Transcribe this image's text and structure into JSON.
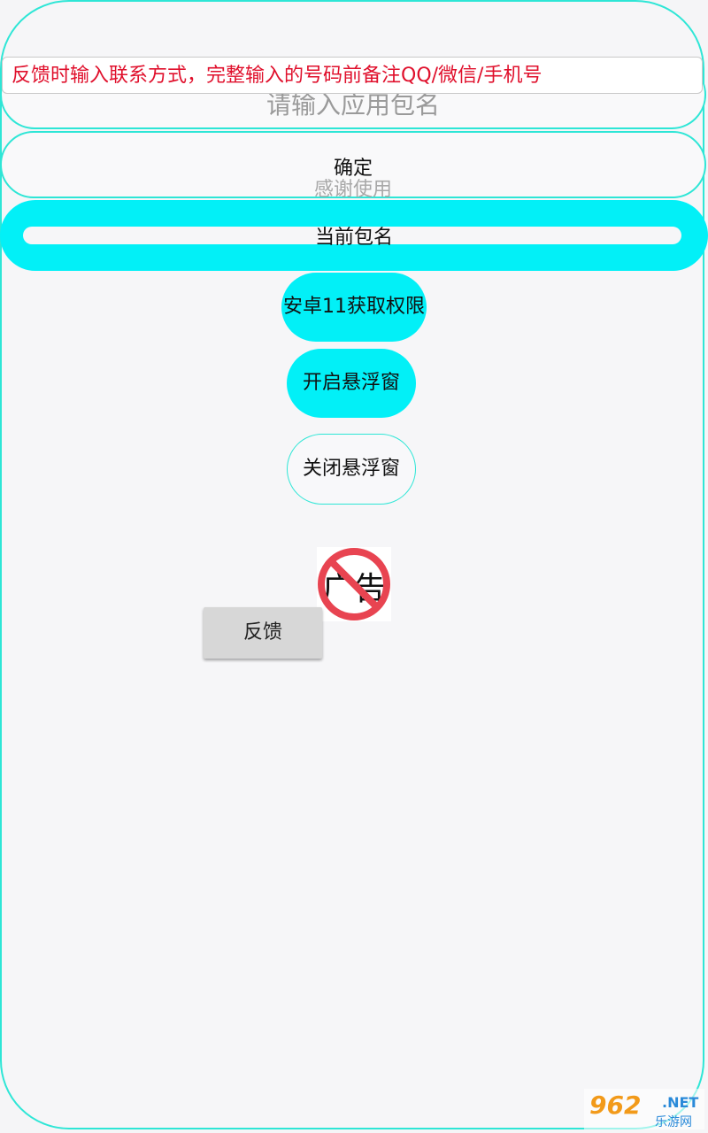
{
  "package_input": {
    "placeholder": "请输入应用包名"
  },
  "tip_banner": {
    "text": "反馈时输入联系方式，完整输入的号码前备注QQ/微信/手机号"
  },
  "confirm": {
    "label": "确定",
    "subtitle": "感谢使用"
  },
  "current_package": {
    "label": "当前包名"
  },
  "buttons": {
    "android11_permission": "安卓11获取权限",
    "open_float": "开启悬浮窗",
    "close_float": "关闭悬浮窗",
    "feedback": "反馈"
  },
  "ad_badge": {
    "text": "广告",
    "icon": "no-ads-icon"
  },
  "watermark": {
    "number": "962",
    "suffix": ".NET",
    "site": "乐游网"
  },
  "colors": {
    "accent": "#02f0f7",
    "border": "#2ee6d6",
    "tip_text": "#e0102c",
    "prohibit": "#e84451"
  }
}
